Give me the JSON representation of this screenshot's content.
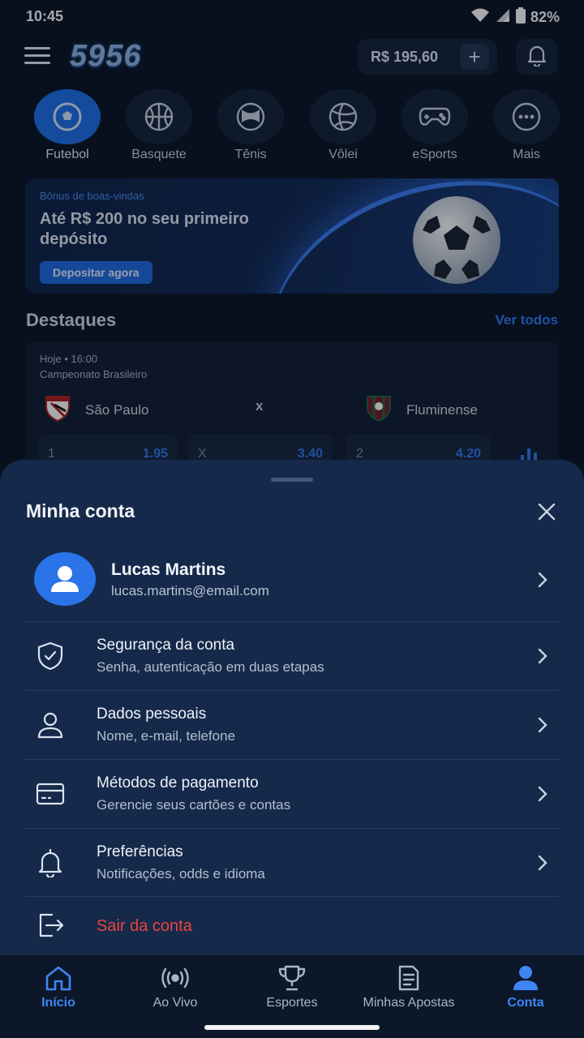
{
  "status_bar": {
    "time": "10:45",
    "battery": "82%"
  },
  "header": {
    "logo": "5956",
    "balance": "R$ 195,60",
    "add_icon": "plus-icon",
    "bell_icon": "bell-icon"
  },
  "sports": [
    {
      "label": "Futebol",
      "icon": "soccer-ball-icon",
      "active": true
    },
    {
      "label": "Basquete",
      "icon": "basketball-icon"
    },
    {
      "label": "Tênis",
      "icon": "tennis-ball-icon"
    },
    {
      "label": "Vôlei",
      "icon": "volleyball-icon"
    },
    {
      "label": "eSports",
      "icon": "gamepad-icon"
    },
    {
      "label": "Mais",
      "icon": "more-dots-icon"
    }
  ],
  "banner": {
    "kicker": "Bônus de boas-vindas",
    "title": "Até R$ 200 no seu primeiro depósito",
    "cta": "Depositar agora"
  },
  "highlights": {
    "title": "Destaques",
    "see_all": "Ver todos",
    "match": {
      "when": "Hoje • 16:00",
      "league": "Campeonato Brasileiro",
      "home": "São Paulo",
      "away": "Fluminense",
      "versus": "x",
      "odds": [
        {
          "key": "1",
          "value": "1.95"
        },
        {
          "key": "X",
          "value": "3.40"
        },
        {
          "key": "2",
          "value": "4.20"
        }
      ]
    }
  },
  "sheet": {
    "title": "Minha conta",
    "profile": {
      "name": "Lucas Martins",
      "email": "lucas.martins@email.com"
    },
    "items": [
      {
        "title": "Segurança da conta",
        "subtitle": "Senha, autenticação em duas etapas",
        "icon": "shield-icon"
      },
      {
        "title": "Dados pessoais",
        "subtitle": "Nome, e-mail, telefone",
        "icon": "user-icon"
      },
      {
        "title": "Métodos de pagamento",
        "subtitle": "Gerencie seus cartões e contas",
        "icon": "credit-card-icon"
      },
      {
        "title": "Preferências",
        "subtitle": "Notificações, odds e idioma",
        "icon": "bell-icon"
      }
    ],
    "logout": "Sair da conta"
  },
  "bottom_nav": [
    {
      "label": "Início",
      "icon": "home-icon",
      "active": true
    },
    {
      "label": "Ao Vivo",
      "icon": "live-broadcast-icon"
    },
    {
      "label": "Esportes",
      "icon": "trophy-icon"
    },
    {
      "label": "Minhas Apostas",
      "icon": "ticket-icon"
    },
    {
      "label": "Conta",
      "icon": "account-icon",
      "active": true
    }
  ],
  "colors": {
    "accent": "#1e6fe8",
    "danger": "#e8453f",
    "sheet": "#15294a",
    "background": "#0b1526"
  }
}
